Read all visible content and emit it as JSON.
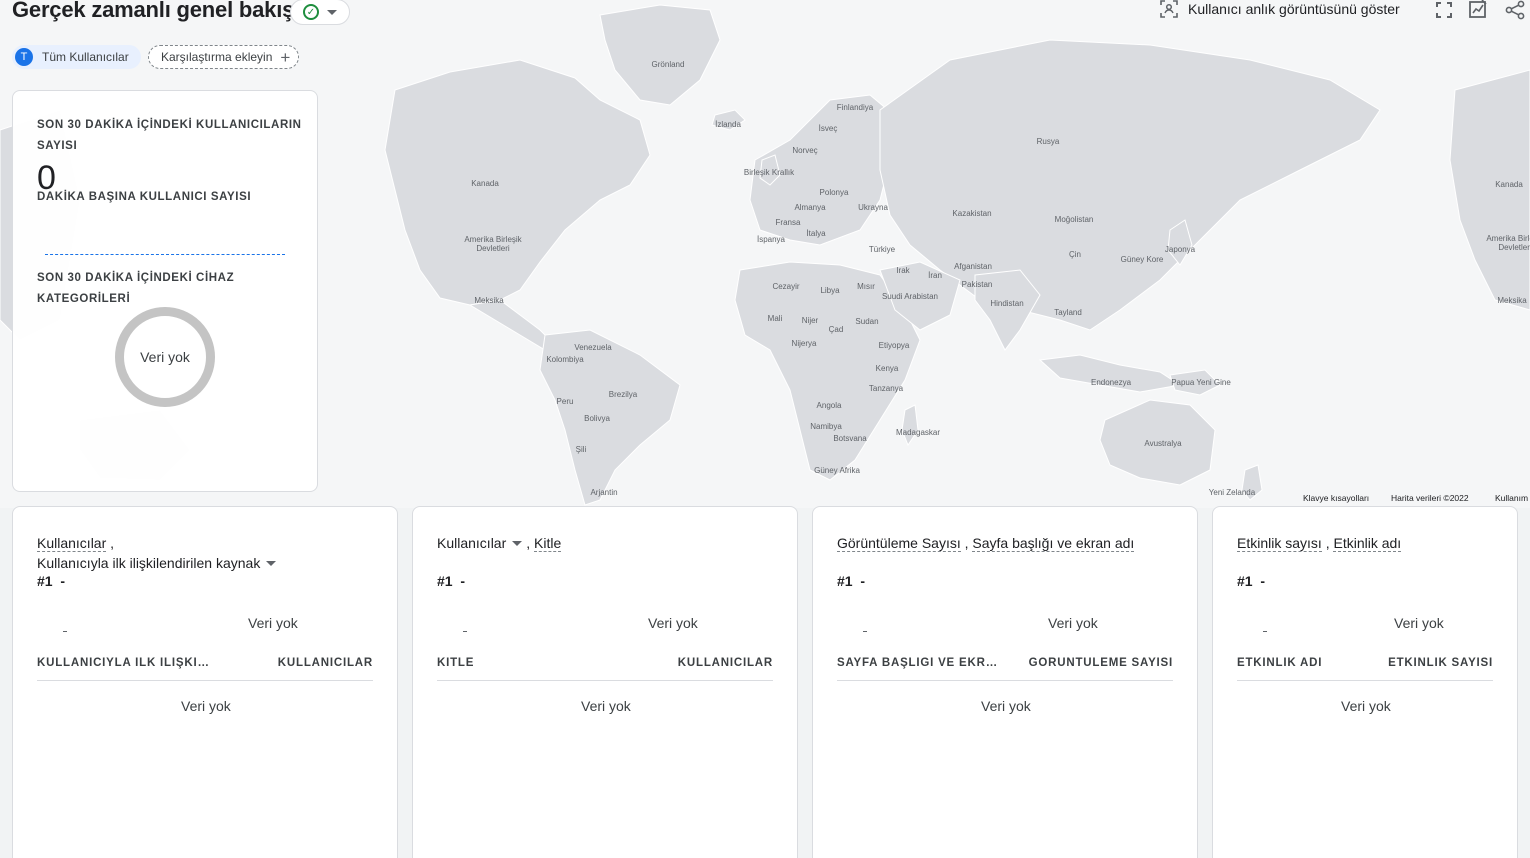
{
  "header": {
    "title": "Gerçek zamanlı genel bakış",
    "snapshot_label": "Kullanıcı anlık görüntüsünü göster"
  },
  "filters": {
    "user_chip_initial": "T",
    "user_chip_label": "Tüm Kullanıcılar",
    "compare_label": "Karşılaştırma ekleyin"
  },
  "summary": {
    "users_caption": "SON 30 DAKİKA İÇİNDEKİ KULLANICILARIN SAYISI",
    "users_value": "0",
    "per_minute_caption": "DAKİKA BAŞINA KULLANICI SAYISI",
    "device_caption": "SON 30 DAKİKA İÇİNDEKİ CİHAZ KATEGORİLERİ",
    "no_data": "Veri yok"
  },
  "map": {
    "footer_shortcuts": "Klavye kısayolları",
    "footer_data": "Harita verileri ©2022",
    "footer_terms": "Kullanım",
    "labels": [
      "Grönland",
      "İzlanda",
      "Finlandiya",
      "İsveç",
      "Norveç",
      "Rusya",
      "Birleşik Krallık",
      "Polonya",
      "Almanya",
      "Ukrayna",
      "Fransa",
      "İtalya",
      "İspanya",
      "Kazakistan",
      "Moğolistan",
      "Türkiye",
      "Çin",
      "Japonya",
      "Güney Kore",
      "Afganistan",
      "Pakistan",
      "Irak",
      "İran",
      "Cezayir",
      "Libya",
      "Mısır",
      "Suudi Arabistan",
      "Hindistan",
      "Tayland",
      "Mali",
      "Nijer",
      "Çad",
      "Sudan",
      "Nijerya",
      "Etiyopya",
      "Kenya",
      "Tanzanya",
      "Angola",
      "Namibya",
      "Botsvana",
      "Madagaskar",
      "Güney Afrika",
      "Kanada",
      "Amerika Birleşik Devletleri",
      "Meksika",
      "Venezuela",
      "Kolombiya",
      "Peru",
      "Brezilya",
      "Bolivya",
      "Şili",
      "Arjantin",
      "Endonezya",
      "Papua Yeni Gine",
      "Avustralya",
      "Yeni Zelanda",
      "Kanada",
      "Amerika Birleşik Devletleri",
      "Meksika"
    ]
  },
  "cards": [
    {
      "title_metric": "Kullanıcılar",
      "title_sep": " ,",
      "title_dimension": "Kullanıcıyla ilk ilişkilendirilen kaynak",
      "rank": "#1",
      "rank_value": "-",
      "no_data_chart": "Veri yok",
      "col_left": "KULLANICIYLA İLK İLİŞKİLENDİRİLEN KAYNAK",
      "col_right": "KULLANICILAR",
      "no_data_table": "Veri yok"
    },
    {
      "title_metric": "Kullanıcılar",
      "title_sep": ",",
      "title_dimension": "Kitle",
      "rank": "#1",
      "rank_value": "-",
      "no_data_chart": "Veri yok",
      "col_left": "KİTLE",
      "col_right": "KULLANICILAR",
      "no_data_table": "Veri yok"
    },
    {
      "title_metric": "Görüntüleme Sayısı",
      "title_sep": " ,",
      "title_dimension": "Sayfa başlığı ve ekran adı",
      "rank": "#1",
      "rank_value": "-",
      "no_data_chart": "Veri yok",
      "col_left": "SAYFA BAŞLIĞI VE EKRAN ADI",
      "col_right": "GÖRÜNTÜLEME SAYISI",
      "no_data_table": "Veri yok"
    },
    {
      "title_metric": "Etkinlik sayısı",
      "title_sep": " ,",
      "title_dimension": "Etkinlik adı",
      "rank": "#1",
      "rank_value": "-",
      "no_data_chart": "Veri yok",
      "col_left": "ETKİNLİK ADI",
      "col_right": "ETKİNLİK SAYISI",
      "no_data_table": "Veri yok"
    }
  ]
}
